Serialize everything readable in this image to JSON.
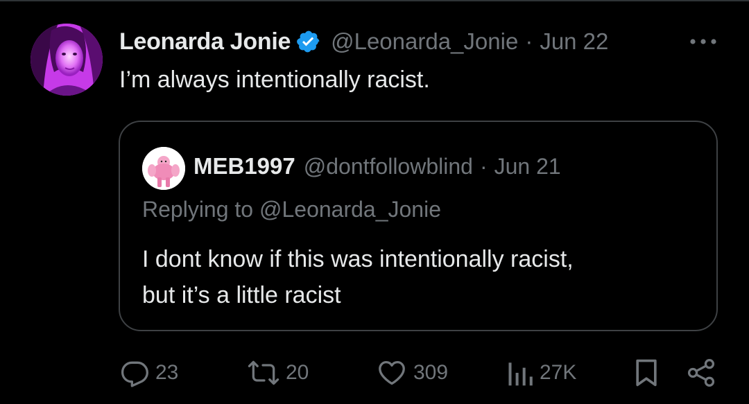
{
  "tweet": {
    "author": {
      "display_name": "Leonarda Jonie",
      "handle": "@Leonarda_Jonie",
      "verified": true
    },
    "separator": "·",
    "date": "Jun 22",
    "text": "I’m always intentionally racist."
  },
  "quoted_tweet": {
    "author": {
      "display_name": "MEB1997",
      "handle": "@dontfollowblind"
    },
    "separator": "·",
    "date": "Jun 21",
    "replying_prefix": "Replying to",
    "replying_to": "@Leonarda_Jonie",
    "text_lines": [
      "I dont know if this was intentionally racist,",
      "but it’s a little racist"
    ]
  },
  "actions": {
    "replies": "23",
    "reposts": "20",
    "likes": "309",
    "views": "27K"
  },
  "icons": {
    "more": "more-horizontal-icon",
    "verified": "verified-badge-icon",
    "reply": "reply-icon",
    "repost": "repost-icon",
    "like": "heart-icon",
    "views": "views-bar-chart-icon",
    "bookmark": "bookmark-icon",
    "share": "share-icon"
  },
  "colors": {
    "background": "#000000",
    "primary_text": "#e7e9ea",
    "secondary_text": "#71767b",
    "border": "#3e4144",
    "verified_blue": "#1d9bf0"
  }
}
